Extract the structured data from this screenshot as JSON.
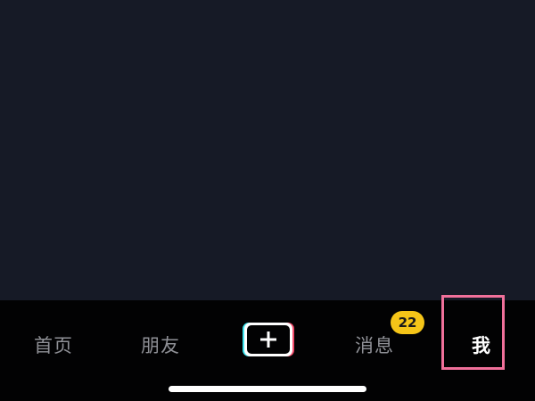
{
  "tab_bar": {
    "home_label": "首页",
    "friends_label": "朋友",
    "create_icon": "plus-icon",
    "messages_label": "消息",
    "messages_badge": "22",
    "me_label": "我"
  },
  "colors": {
    "background": "#161a26",
    "tab_bar_background": "#020203",
    "inactive_tab": "#8f9096",
    "active_tab": "#ffffff",
    "badge": "#f5c518",
    "highlight": "#f0709a",
    "create_cyan": "#3ee6f0",
    "create_red": "#f24a6a"
  }
}
